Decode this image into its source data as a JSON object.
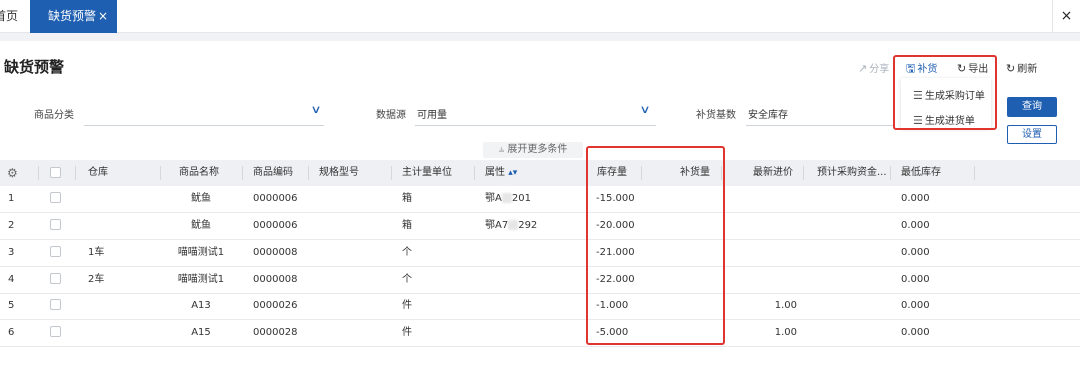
{
  "tabs": {
    "home_label": "首页",
    "active_label": "缺货预警",
    "active_close": "×",
    "bar_close": "×"
  },
  "page": {
    "title": "缺货预警"
  },
  "toolbar": {
    "share": "分享",
    "replenish": "补货",
    "export": "导出",
    "refresh": "刷新",
    "dropdown": [
      "生成采购订单",
      "生成进货单"
    ]
  },
  "filters": {
    "category_label": "商品分类",
    "category_value": "",
    "source_label": "数据源",
    "source_value": "可用量",
    "basis_label": "补货基数",
    "basis_value": "安全库存",
    "query_button": "查询",
    "settings_button": "设置",
    "expand_more": "展开更多条件"
  },
  "table": {
    "columns": [
      "仓库",
      "商品名称",
      "商品编码",
      "规格型号",
      "主计量单位",
      "属性",
      "库存量",
      "补货量",
      "最新进价",
      "预计采购资金...",
      "最低库存"
    ],
    "rows": [
      {
        "no": "1",
        "warehouse": "",
        "name": "鱿鱼",
        "code": "0000006",
        "spec": "",
        "unit": "箱",
        "attr_a": "鄂A",
        "attr_b": "201",
        "stock": "-15.000",
        "replenish": "",
        "price": "",
        "fund": "",
        "min": "0.000"
      },
      {
        "no": "2",
        "warehouse": "",
        "name": "鱿鱼",
        "code": "0000006",
        "spec": "",
        "unit": "箱",
        "attr_a": "鄂A7",
        "attr_b": "292",
        "stock": "-20.000",
        "replenish": "",
        "price": "",
        "fund": "",
        "min": "0.000"
      },
      {
        "no": "3",
        "warehouse": "1车",
        "name": "喵喵测试1",
        "code": "0000008",
        "spec": "",
        "unit": "个",
        "attr_a": "",
        "attr_b": "",
        "stock": "-21.000",
        "replenish": "",
        "price": "",
        "fund": "",
        "min": "0.000"
      },
      {
        "no": "4",
        "warehouse": "2车",
        "name": "喵喵测试1",
        "code": "0000008",
        "spec": "",
        "unit": "个",
        "attr_a": "",
        "attr_b": "",
        "stock": "-22.000",
        "replenish": "",
        "price": "",
        "fund": "",
        "min": "0.000"
      },
      {
        "no": "5",
        "warehouse": "",
        "name": "A13",
        "code": "0000026",
        "spec": "",
        "unit": "件",
        "attr_a": "",
        "attr_b": "",
        "stock": "-1.000",
        "replenish": "",
        "price": "1.00",
        "fund": "",
        "min": "0.000"
      },
      {
        "no": "6",
        "warehouse": "",
        "name": "A15",
        "code": "0000028",
        "spec": "",
        "unit": "件",
        "attr_a": "",
        "attr_b": "",
        "stock": "-5.000",
        "replenish": "",
        "price": "1.00",
        "fund": "",
        "min": "0.000"
      }
    ]
  },
  "icons": {
    "column_settings": "gear-icon",
    "share": "share-icon",
    "replenish": "replenish-icon",
    "export": "export-icon",
    "refresh": "refresh-icon"
  },
  "colors": {
    "accent": "#1f5fb2",
    "highlight": "#e0342f"
  }
}
